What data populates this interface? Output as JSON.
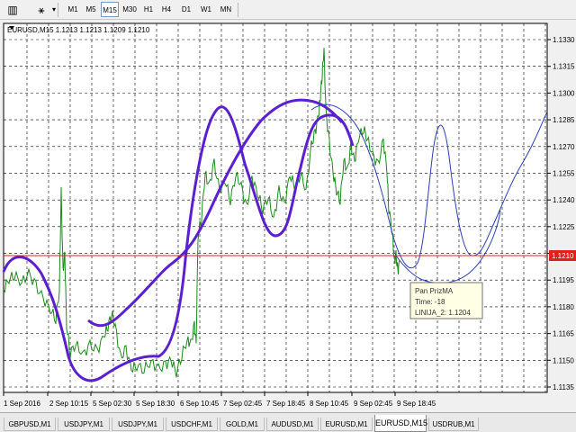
{
  "toolbar": {
    "icons": [
      "bar-chart-icon",
      "shapes-icon"
    ],
    "timeframes": [
      "M1",
      "M5",
      "M15",
      "M30",
      "H1",
      "H4",
      "D1",
      "W1",
      "MN"
    ],
    "active_timeframe": "M15"
  },
  "chart": {
    "header": "EURUSD,M15  1.1213 1.1213 1.1209 1.1210",
    "price_labels": [
      "1.1330",
      "1.1315",
      "1.1300",
      "1.1285",
      "1.1270",
      "1.1255",
      "1.1240",
      "1.1225",
      "1.1210",
      "1.1195",
      "1.1180",
      "1.1165",
      "1.1150",
      "1.1135"
    ],
    "time_labels": [
      "1 Sep 2016",
      "2 Sep 10:15",
      "5 Sep 02:30",
      "5 Sep 18:30",
      "6 Sep 10:45",
      "7 Sep 02:45",
      "7 Sep 18:45",
      "8 Sep 10:45",
      "9 Sep 02:45",
      "9 Sep 18:45"
    ],
    "current_price": "1.1210",
    "colors": {
      "background": "#ffffff",
      "price": "#1a8a1a",
      "thick_ma": "#5b1fd1",
      "thin_ma": "#2b3fb8",
      "hline": "#e02020"
    },
    "tooltip": {
      "line1": "Pan PrizMA",
      "line2": "Time: -18",
      "line3": "LINIJA_2: 1.1204"
    }
  },
  "tabs": [
    "GBPUSD,M1",
    "USDJPY,M1",
    "USDJPY,M1",
    "USDCHF,M1",
    "GOLD,M1",
    "AUDUSD,M1",
    "EURUSD,M1",
    "EURUSD,M15",
    "USDRUB,M1"
  ],
  "active_tab": "EURUSD,M15"
}
